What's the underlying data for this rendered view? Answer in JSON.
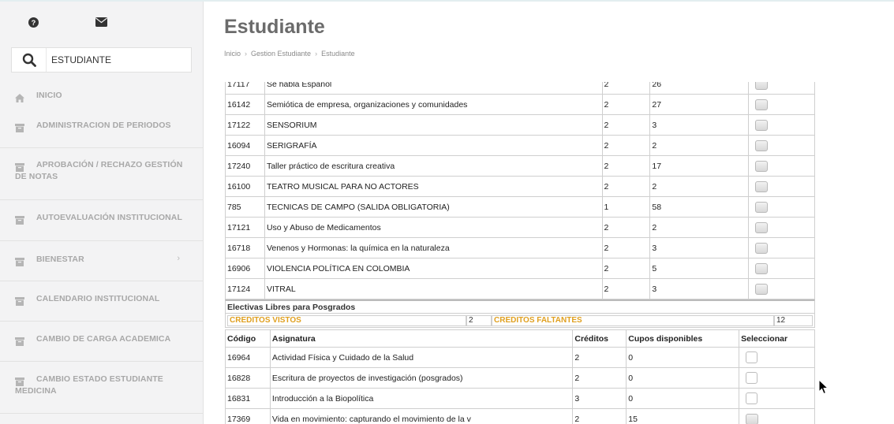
{
  "search": {
    "value": "ESTUDIANTE"
  },
  "sidebar": {
    "items": [
      {
        "label": "INICIO",
        "icon": "home-icon"
      },
      {
        "label": "ADMINISTRACION DE PERIODOS",
        "icon": "archive-icon"
      },
      {
        "label": "APROBACIÓN / RECHAZO GESTIÓN DE NOTAS",
        "icon": "archive-icon"
      },
      {
        "label": "AUTOEVALUACIÓN INSTITUCIONAL",
        "icon": "archive-icon"
      },
      {
        "label": "BIENESTAR",
        "icon": "archive-icon",
        "chevron": "›"
      },
      {
        "label": "CALENDARIO INSTITUCIONAL",
        "icon": "archive-icon"
      },
      {
        "label": "CAMBIO DE CARGA ACADEMICA",
        "icon": "archive-icon"
      },
      {
        "label": "CAMBIO ESTADO ESTUDIANTE MEDICINA",
        "icon": "archive-icon"
      }
    ]
  },
  "page": {
    "title": "Estudiante",
    "breadcrumb": [
      "Inicio",
      "Gestion Estudiante",
      "Estudiante"
    ]
  },
  "electivas": {
    "rows": [
      {
        "code": "17117",
        "name": "Se habla Español",
        "credits": "2",
        "cupos": "26"
      },
      {
        "code": "16142",
        "name": "Semiótica de empresa, organizaciones y comunidades",
        "credits": "2",
        "cupos": "27"
      },
      {
        "code": "17122",
        "name": "SENSORIUM",
        "credits": "2",
        "cupos": "3"
      },
      {
        "code": "16094",
        "name": "SERIGRAFÍA",
        "credits": "2",
        "cupos": "2"
      },
      {
        "code": "17240",
        "name": "Taller práctico de escritura creativa",
        "credits": "2",
        "cupos": "17"
      },
      {
        "code": "16100",
        "name": "TEATRO MUSICAL PARA NO ACTORES",
        "credits": "2",
        "cupos": "2"
      },
      {
        "code": "785",
        "name": "TECNICAS DE CAMPO (SALIDA OBLIGATORIA)",
        "credits": "1",
        "cupos": "58"
      },
      {
        "code": "17121",
        "name": "Uso y Abuso de Medicamentos",
        "credits": "2",
        "cupos": "2"
      },
      {
        "code": "16718",
        "name": "Venenos y Hormonas: la química en la naturaleza",
        "credits": "2",
        "cupos": "3"
      },
      {
        "code": "16906",
        "name": "VIOLENCIA POLÍTICA EN COLOMBIA",
        "credits": "2",
        "cupos": "5"
      },
      {
        "code": "17124",
        "name": "VITRAL",
        "credits": "2",
        "cupos": "3"
      }
    ]
  },
  "posgrados": {
    "title": "Electivas Libres para Posgrados",
    "creditos_vistos_label": "CREDITOS VISTOS",
    "creditos_vistos": "2",
    "creditos_faltantes_label": "CREDITOS FALTANTES",
    "creditos_faltantes": "12",
    "headers": [
      "Código",
      "Asignatura",
      "Créditos",
      "Cupos disponibles",
      "Seleccionar"
    ],
    "rows": [
      {
        "code": "16964",
        "name": "Actividad Física y Cuidado de la Salud",
        "credits": "2",
        "cupos": "0"
      },
      {
        "code": "16828",
        "name": "Escritura de proyectos de investigación (posgrados)",
        "credits": "2",
        "cupos": "0"
      },
      {
        "code": "16831",
        "name": "Introducción a la Biopolítica",
        "credits": "3",
        "cupos": "0"
      },
      {
        "code": "17369",
        "name": "Vida en movimiento: capturando el movimiento de la v",
        "credits": "2",
        "cupos": "15"
      }
    ]
  }
}
